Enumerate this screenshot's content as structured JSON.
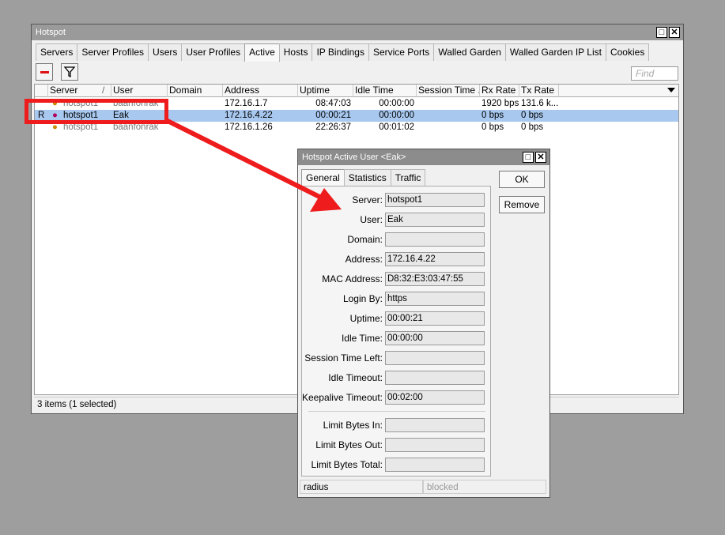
{
  "window": {
    "title": "Hotspot",
    "tabs": [
      "Servers",
      "Server Profiles",
      "Users",
      "User Profiles",
      "Active",
      "Hosts",
      "IP Bindings",
      "Service Ports",
      "Walled Garden",
      "Walled Garden IP List",
      "Cookies"
    ],
    "active_tab": "Active",
    "find_placeholder": "Find"
  },
  "table": {
    "columns": [
      "Server",
      "User",
      "Domain",
      "Address",
      "Uptime",
      "Idle Time",
      "Session Time ...",
      "Rx Rate",
      "Tx Rate"
    ],
    "sort_indicator": "/",
    "rows": [
      {
        "flag": "",
        "server": "hotspot1",
        "user": "baanfonrak",
        "domain": "",
        "address": "172.16.1.7",
        "uptime": "08:47:03",
        "idle": "00:00:00",
        "session": "",
        "rx": "1920 bps",
        "tx": "131.6 k..."
      },
      {
        "flag": "R",
        "server": "hotspot1",
        "user": "Eak",
        "domain": "",
        "address": "172.16.4.22",
        "uptime": "00:00:21",
        "idle": "00:00:00",
        "session": "",
        "rx": "0 bps",
        "tx": "0 bps"
      },
      {
        "flag": "",
        "server": "hotspot1",
        "user": "baanfonrak",
        "domain": "",
        "address": "172.16.1.26",
        "uptime": "22:26:37",
        "idle": "00:01:02",
        "session": "",
        "rx": "0 bps",
        "tx": "0 bps"
      }
    ],
    "status": "3 items (1 selected)"
  },
  "dialog": {
    "title": "Hotspot Active User <Eak>",
    "tabs": [
      "General",
      "Statistics",
      "Traffic"
    ],
    "fields": [
      {
        "label": "Server:",
        "value": "hotspot1"
      },
      {
        "label": "User:",
        "value": "Eak"
      },
      {
        "label": "Domain:",
        "value": ""
      },
      {
        "label": "Address:",
        "value": "172.16.4.22"
      },
      {
        "label": "MAC Address:",
        "value": "D8:32:E3:03:47:55"
      },
      {
        "label": "Login By:",
        "value": "https"
      },
      {
        "label": "Uptime:",
        "value": "00:00:21"
      },
      {
        "label": "Idle Time:",
        "value": "00:00:00"
      },
      {
        "label": "Session Time Left:",
        "value": ""
      },
      {
        "label": "Idle Timeout:",
        "value": ""
      },
      {
        "label": "Keepalive Timeout:",
        "value": "00:02:00"
      },
      {
        "label": "Limit Bytes In:",
        "value": ""
      },
      {
        "label": "Limit Bytes Out:",
        "value": ""
      },
      {
        "label": "Limit Bytes Total:",
        "value": ""
      }
    ],
    "ok_label": "OK",
    "remove_label": "Remove",
    "status_left": "radius",
    "status_right": "blocked"
  },
  "colors": {
    "annotation": "#ee1c1c",
    "selection": "#a8c8ef"
  }
}
